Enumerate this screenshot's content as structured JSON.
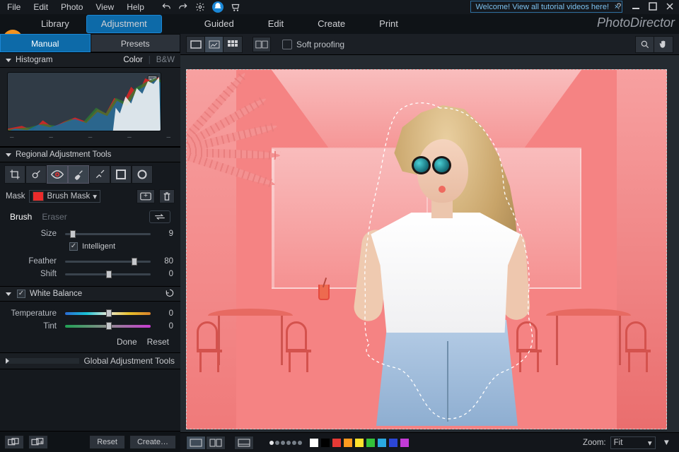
{
  "menu": {
    "file": "File",
    "edit": "Edit",
    "photo": "Photo",
    "view": "View",
    "help": "Help"
  },
  "tutorial_pill": "Welcome! View all tutorial videos here!",
  "brand": "PhotoDirector",
  "toptabs": {
    "library": "Library",
    "adjustment": "Adjustment",
    "guided": "Guided",
    "edit": "Edit",
    "create": "Create",
    "print": "Print"
  },
  "subtabs": {
    "manual": "Manual",
    "presets": "Presets"
  },
  "sections": {
    "histogram": "Histogram",
    "histogram_modes": {
      "color": "Color",
      "bw": "B&W"
    },
    "regional": "Regional Adjustment Tools",
    "global": "Global Adjustment Tools",
    "white_balance": "White Balance"
  },
  "mask": {
    "label": "Mask",
    "name": "Brush Mask"
  },
  "modes": {
    "brush": "Brush",
    "eraser": "Eraser"
  },
  "sliders": {
    "size": {
      "label": "Size",
      "value": "9"
    },
    "intelligent": "Intelligent",
    "feather": {
      "label": "Feather",
      "value": "80"
    },
    "shift": {
      "label": "Shift",
      "value": "0"
    },
    "temperature": {
      "label": "Temperature",
      "value": "0"
    },
    "tint": {
      "label": "Tint",
      "value": "0"
    }
  },
  "buttons": {
    "done": "Done",
    "reset": "Reset",
    "create": "Create…"
  },
  "soft_proofing": "Soft proofing",
  "zoom": {
    "label": "Zoom:",
    "value": "Fit"
  },
  "swatches": [
    "#ffffff",
    "#000000",
    "#e53935",
    "#ff9a1f",
    "#ffe22e",
    "#34c13a",
    "#2aa8e0",
    "#2b46d6",
    "#c23bd6"
  ],
  "histogram_ticks": [
    "–",
    "–",
    "–",
    "–",
    "–"
  ]
}
